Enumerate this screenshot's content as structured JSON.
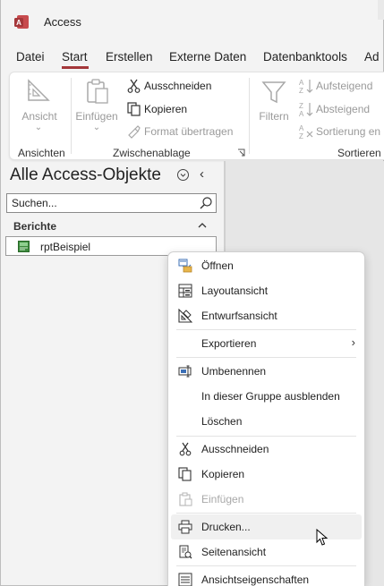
{
  "app": {
    "title": "Access",
    "brand_color": "#a4373a"
  },
  "tabs": [
    "Datei",
    "Start",
    "Erstellen",
    "Externe Daten",
    "Datenbanktools",
    "Ad"
  ],
  "active_tab": "Start",
  "ribbon": {
    "ansicht_label": "Ansicht",
    "einfuegen_label": "Einfügen",
    "ausschneiden": "Ausschneiden",
    "kopieren": "Kopieren",
    "format_uebertragen": "Format übertragen",
    "filtern_label": "Filtern",
    "aufsteigend": "Aufsteigend",
    "absteigend": "Absteigend",
    "sortierung_entfernen": "Sortierung en",
    "groups": {
      "ansichten": "Ansichten",
      "zwischenablage": "Zwischenablage",
      "sortieren": "Sortieren"
    }
  },
  "navpane": {
    "title": "Alle Access-Objekte",
    "search_text": "Suchen...",
    "group": "Berichte",
    "item": "rptBeispiel"
  },
  "context_menu": {
    "items": [
      {
        "label": "Öffnen",
        "icon": "open-icon",
        "enabled": true
      },
      {
        "label": "Layoutansicht",
        "icon": "layout-view-icon",
        "enabled": true
      },
      {
        "label": "Entwurfsansicht",
        "icon": "design-view-icon",
        "enabled": true
      },
      {
        "label": "Exportieren",
        "icon": "",
        "enabled": true,
        "submenu": true
      },
      {
        "label": "Umbenennen",
        "icon": "rename-icon",
        "enabled": true
      },
      {
        "label": "In dieser Gruppe ausblenden",
        "icon": "",
        "enabled": true
      },
      {
        "label": "Löschen",
        "icon": "",
        "enabled": true
      },
      {
        "label": "Ausschneiden",
        "icon": "cut-icon",
        "enabled": true
      },
      {
        "label": "Kopieren",
        "icon": "copy-icon",
        "enabled": true
      },
      {
        "label": "Einfügen",
        "icon": "paste-icon",
        "enabled": false
      },
      {
        "label": "Drucken...",
        "icon": "print-icon",
        "enabled": true,
        "hover": true
      },
      {
        "label": "Seitenansicht",
        "icon": "print-preview-icon",
        "enabled": true
      },
      {
        "label": "Ansichtseigenschaften",
        "icon": "properties-icon",
        "enabled": true
      }
    ]
  }
}
